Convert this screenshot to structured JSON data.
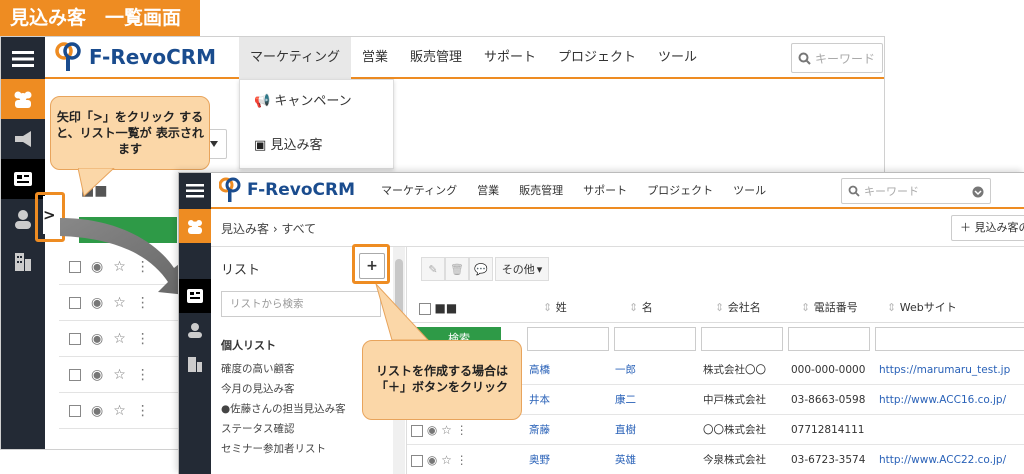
{
  "page_title": "見込み客　一覧画面",
  "brand": {
    "logo_text": "F-RevoCRM",
    "primary": "#1a4c8e",
    "accent": "#ee8c22",
    "sidebar": "#232a35"
  },
  "back_window": {
    "nav": [
      "マーケティング",
      "営業",
      "販売管理",
      "サポート",
      "プロジェクト",
      "ツール"
    ],
    "search_placeholder": "キーワード",
    "marketing_menu": [
      "キャンペーン",
      "見込み客"
    ]
  },
  "front_window": {
    "nav": [
      "マーケティング",
      "営業",
      "販売管理",
      "サポート",
      "プロジェクト",
      "ツール"
    ],
    "search_placeholder": "キーワード",
    "breadcrumb": "見込み客 › すべて",
    "add_button": "＋ 見込み客の",
    "list_panel": {
      "title": "リスト",
      "add_button": "+",
      "search_placeholder": "リストから検索",
      "section": "個人リスト",
      "items": [
        "確度の高い顧客",
        "今月の見込み客",
        "●佐藤さんの担当見込み客",
        "ステータス確認",
        "セミナー参加者リスト"
      ]
    },
    "toolbar": {
      "more": "その他"
    },
    "columns": [
      "姓",
      "名",
      "会社名",
      "電話番号",
      "Webサイト"
    ],
    "search_button": "検索",
    "rows": [
      {
        "last": "高橋",
        "first": "一郎",
        "company": "株式会社〇〇",
        "phone": "000-000-0000",
        "web": "https://marumaru_test.jp"
      },
      {
        "last": "井本",
        "first": "康二",
        "company": "中戸株式会社",
        "phone": "03-8663-0598",
        "web": "http://www.ACC16.co.jp/"
      },
      {
        "last": "斎藤",
        "first": "直樹",
        "company": "〇〇株式会社",
        "phone": "07712814111",
        "web": ""
      },
      {
        "last": "奥野",
        "first": "英雄",
        "company": "今泉株式会社",
        "phone": "03-6723-3574",
        "web": "http://www.ACC22.co.jp/"
      }
    ]
  },
  "callouts": {
    "arrow_tip": "矢印「>」をクリック すると、リスト一覧が 表示されます",
    "add_tip": "リストを作成する場合は 「＋」ボタンをクリック"
  }
}
